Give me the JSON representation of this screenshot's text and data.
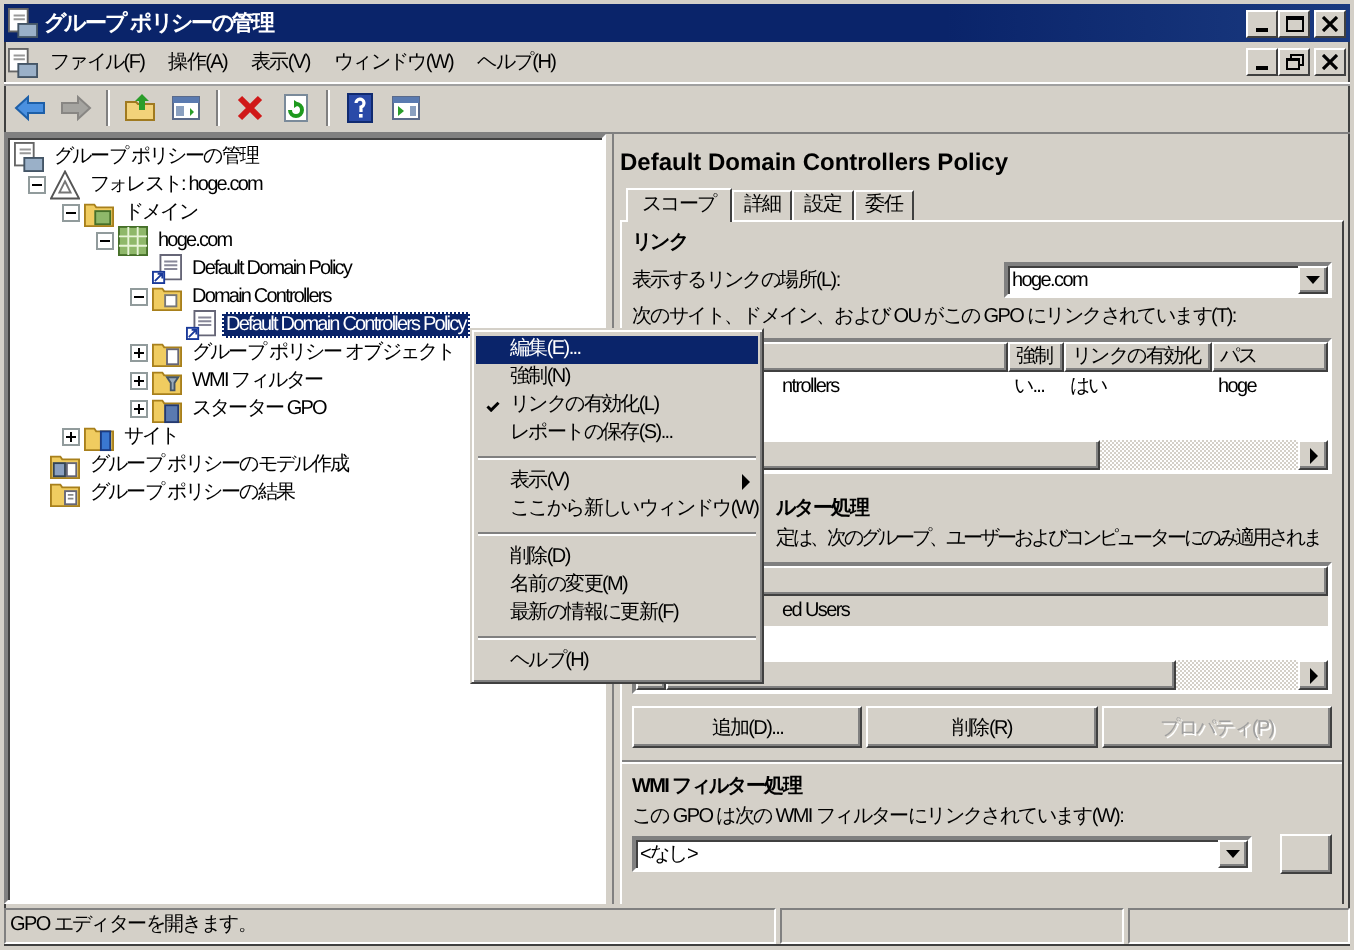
{
  "window": {
    "title": "グループ ポリシーの管理"
  },
  "menu_bar": [
    "ファイル(F)",
    "操作(A)",
    "表示(V)",
    "ウィンドウ(W)",
    "ヘルプ(H)"
  ],
  "toolbar": [
    {
      "kind": "back",
      "disabled": false
    },
    {
      "kind": "forward",
      "disabled": true
    },
    {
      "kind": "separator"
    },
    {
      "kind": "up",
      "disabled": false
    },
    {
      "kind": "tree-toggle",
      "disabled": false
    },
    {
      "kind": "separator"
    },
    {
      "kind": "delete",
      "disabled": false
    },
    {
      "kind": "refresh",
      "disabled": false
    },
    {
      "kind": "separator"
    },
    {
      "kind": "help",
      "disabled": false
    },
    {
      "kind": "pane",
      "disabled": false
    }
  ],
  "tree": [
    {
      "label": "グループ ポリシーの管理",
      "kind": "console",
      "toggle": false,
      "expanded": true,
      "selected": false,
      "children": [
        {
          "label": "フォレスト: hoge.com",
          "kind": "forest",
          "toggle": true,
          "expanded": true,
          "selected": false,
          "children": [
            {
              "label": "ドメイン",
              "kind": "domains",
              "toggle": true,
              "expanded": true,
              "selected": false,
              "children": [
                {
                  "label": "hoge.com",
                  "kind": "domain",
                  "toggle": true,
                  "expanded": true,
                  "selected": false,
                  "children": [
                    {
                      "label": "Default Domain Policy",
                      "kind": "gpo-link",
                      "toggle": false,
                      "selected": false
                    },
                    {
                      "label": "Domain Controllers",
                      "kind": "ou",
                      "toggle": true,
                      "expanded": true,
                      "selected": false,
                      "children": [
                        {
                          "label": "Default Domain Controllers Policy",
                          "kind": "gpo-link",
                          "toggle": false,
                          "selected": true
                        }
                      ]
                    },
                    {
                      "label": "グループ ポリシー オブジェクト",
                      "kind": "gpo-folder",
                      "toggle": true,
                      "expanded": false,
                      "selected": false
                    },
                    {
                      "label": "WMI フィルター",
                      "kind": "wmi-folder",
                      "toggle": true,
                      "expanded": false,
                      "selected": false
                    },
                    {
                      "label": "スターター GPO",
                      "kind": "starter-folder",
                      "toggle": true,
                      "expanded": false,
                      "selected": false
                    }
                  ]
                }
              ]
            },
            {
              "label": "サイト",
              "kind": "sites",
              "toggle": true,
              "expanded": false,
              "selected": false
            }
          ]
        },
        {
          "label": "グループ ポリシーのモデル作成",
          "kind": "modeling",
          "toggle": false,
          "selected": false
        },
        {
          "label": "グループ ポリシーの結果",
          "kind": "results",
          "toggle": false,
          "selected": false
        }
      ]
    }
  ],
  "details": {
    "title": "Default Domain Controllers Policy",
    "tabs": [
      {
        "label": "スコープ",
        "selected": true
      },
      {
        "label": "詳細",
        "selected": false
      },
      {
        "label": "設定",
        "selected": false
      },
      {
        "label": "委任",
        "selected": false
      }
    ],
    "links": {
      "heading": "リンク",
      "location_label": "表示するリンクの場所(L):",
      "location_value": "hoge.com",
      "list_label": "次のサイト、ドメイン、および OU がこの GPO にリンクされています(T):",
      "columns": [
        "",
        "強制",
        "リンクの有効化",
        "パス"
      ],
      "rows": [
        {
          "cells": [
            "ntrollers",
            "い...",
            "はい",
            "hoge"
          ]
        }
      ]
    },
    "security_filtering": {
      "heading": "ルター処理",
      "description": "定は、次のグループ、ユーザーおよびコンピューターにのみ適用されま",
      "rows": [
        {
          "cells": [
            "ed Users"
          ],
          "selected": true
        }
      ],
      "buttons": [
        {
          "label": "追加(D)...",
          "disabled": false
        },
        {
          "label": "削除(R)",
          "disabled": false
        },
        {
          "label": "プロパティ(P)",
          "disabled": true
        }
      ]
    },
    "wmi_filtering": {
      "heading": "WMI フィルター処理",
      "description": "この GPO は次の WMI フィルターにリンクされています(W):",
      "value": "<なし>",
      "side_button_disabled": true
    }
  },
  "context_menu": [
    {
      "kind": "item",
      "label": "編集(E)...",
      "highlighted": true,
      "checked": false,
      "submenu": false
    },
    {
      "kind": "item",
      "label": "強制(N)",
      "highlighted": false,
      "checked": false,
      "submenu": false
    },
    {
      "kind": "item",
      "label": "リンクの有効化(L)",
      "highlighted": false,
      "checked": true,
      "submenu": false
    },
    {
      "kind": "item",
      "label": "レポートの保存(S)...",
      "highlighted": false,
      "checked": false,
      "submenu": false
    },
    {
      "kind": "separator"
    },
    {
      "kind": "item",
      "label": "表示(V)",
      "highlighted": false,
      "checked": false,
      "submenu": true
    },
    {
      "kind": "item",
      "label": "ここから新しいウィンドウ(W)",
      "highlighted": false,
      "checked": false,
      "submenu": false
    },
    {
      "kind": "separator"
    },
    {
      "kind": "item",
      "label": "削除(D)",
      "highlighted": false,
      "checked": false,
      "submenu": false
    },
    {
      "kind": "item",
      "label": "名前の変更(M)",
      "highlighted": false,
      "checked": false,
      "submenu": false
    },
    {
      "kind": "item",
      "label": "最新の情報に更新(F)",
      "highlighted": false,
      "checked": false,
      "submenu": false
    },
    {
      "kind": "separator"
    },
    {
      "kind": "item",
      "label": "ヘルプ(H)",
      "highlighted": false,
      "checked": false,
      "submenu": false
    }
  ],
  "status_bar": {
    "text": "GPO エディターを開きます。"
  }
}
